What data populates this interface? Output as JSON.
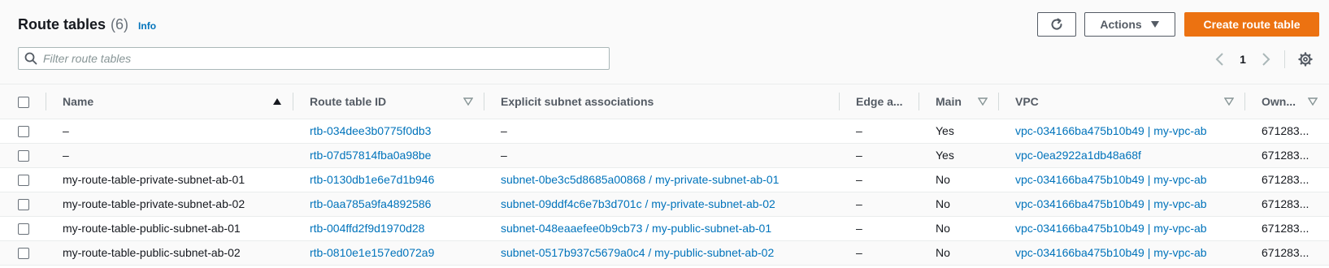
{
  "header": {
    "title": "Route tables",
    "count": "(6)",
    "info": "Info",
    "refresh_icon": "refresh-icon",
    "actions_label": "Actions",
    "create_label": "Create route table"
  },
  "search": {
    "placeholder": "Filter route tables",
    "value": ""
  },
  "pagination": {
    "page": "1"
  },
  "columns": [
    {
      "label": "Name",
      "sort": "ascending"
    },
    {
      "label": "Route table ID",
      "sort": "filter"
    },
    {
      "label": "Explicit subnet associations",
      "sort": "none"
    },
    {
      "label": "Edge a...",
      "sort": "none"
    },
    {
      "label": "Main",
      "sort": "filter"
    },
    {
      "label": "VPC",
      "sort": "filter"
    },
    {
      "label": "Own...",
      "sort": "filter"
    }
  ],
  "rows": [
    {
      "name": "–",
      "id": "rtb-034dee3b0775f0db3",
      "subnets": "–",
      "edge": "–",
      "main": "Yes",
      "vpc": "vpc-034166ba475b10b49 | my-vpc-ab",
      "owner": "671283..."
    },
    {
      "name": "–",
      "id": "rtb-07d57814fba0a98be",
      "subnets": "–",
      "edge": "–",
      "main": "Yes",
      "vpc": "vpc-0ea2922a1db48a68f",
      "owner": "671283..."
    },
    {
      "name": "my-route-table-private-subnet-ab-01",
      "id": "rtb-0130db1e6e7d1b946",
      "subnets": "subnet-0be3c5d8685a00868 / my-private-subnet-ab-01",
      "edge": "–",
      "main": "No",
      "vpc": "vpc-034166ba475b10b49 | my-vpc-ab",
      "owner": "671283..."
    },
    {
      "name": "my-route-table-private-subnet-ab-02",
      "id": "rtb-0aa785a9fa4892586",
      "subnets": "subnet-09ddf4c6e7b3d701c / my-private-subnet-ab-02",
      "edge": "–",
      "main": "No",
      "vpc": "vpc-034166ba475b10b49 | my-vpc-ab",
      "owner": "671283..."
    },
    {
      "name": "my-route-table-public-subnet-ab-01",
      "id": "rtb-004ffd2f9d1970d28",
      "subnets": "subnet-048eaaefee0b9cb73 / my-public-subnet-ab-01",
      "edge": "–",
      "main": "No",
      "vpc": "vpc-034166ba475b10b49 | my-vpc-ab",
      "owner": "671283..."
    },
    {
      "name": "my-route-table-public-subnet-ab-02",
      "id": "rtb-0810e1e157ed072a9",
      "subnets": "subnet-0517b937c5679a0c4 / my-public-subnet-ab-02",
      "edge": "–",
      "main": "No",
      "vpc": "vpc-034166ba475b10b49 | my-vpc-ab",
      "owner": "671283..."
    }
  ],
  "colors": {
    "link": "#0073bb",
    "primary": "#ec7211",
    "text": "#16191f",
    "muted": "#545b64"
  }
}
